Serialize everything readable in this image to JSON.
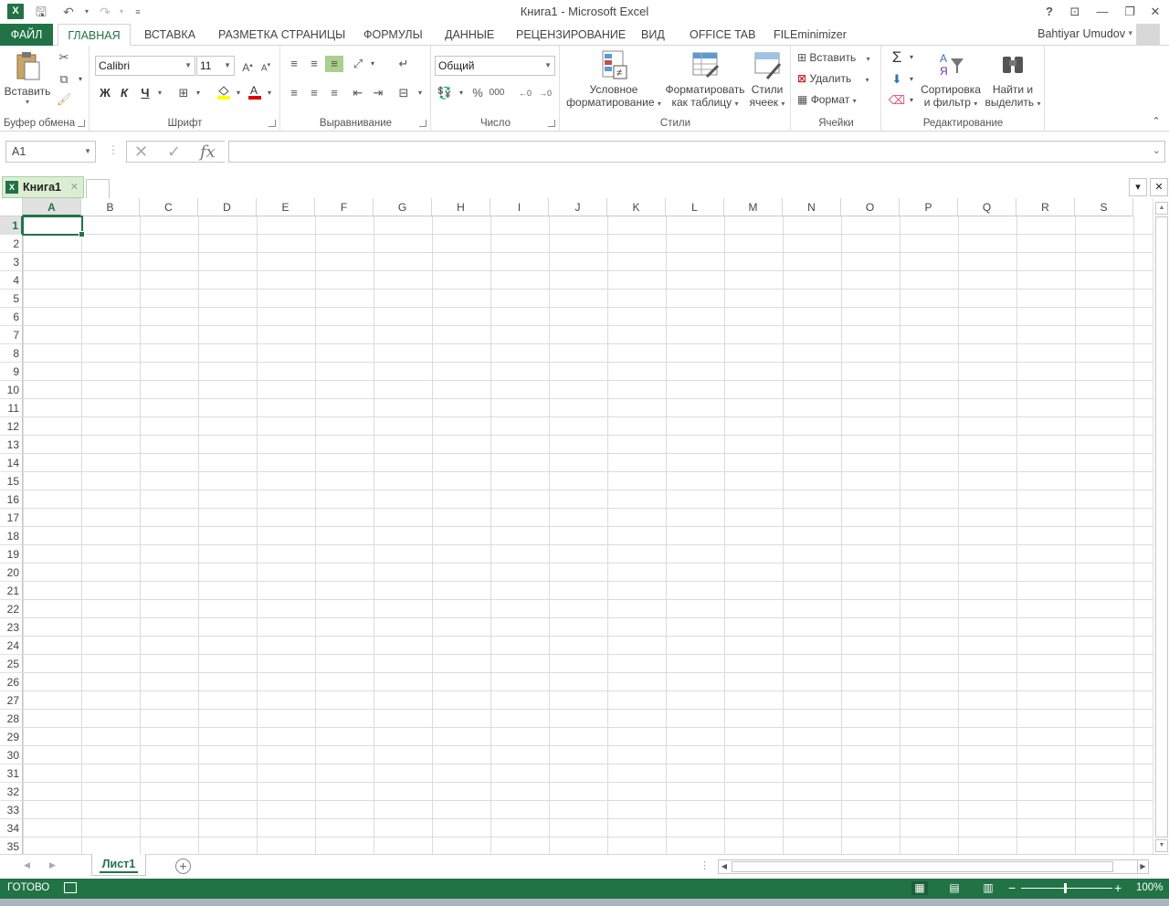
{
  "window": {
    "title": "Книга1 - Microsoft Excel",
    "help": "?",
    "minimize": "—",
    "restore": "❐",
    "close": "✕"
  },
  "tabs": [
    "ФАЙЛ",
    "ГЛАВНАЯ",
    "ВСТАВКА",
    "РАЗМЕТКА СТРАНИЦЫ",
    "ФОРМУЛЫ",
    "ДАННЫЕ",
    "РЕЦЕНЗИРОВАНИЕ",
    "ВИД",
    "OFFICE TAB",
    "FILEminimizer"
  ],
  "user": "Bahtiyar Umudov",
  "ribbon": {
    "clipboard": {
      "label": "Буфер обмена",
      "paste": "Вставить"
    },
    "font": {
      "label": "Шрифт",
      "font_name": "Calibri",
      "font_size": "11",
      "bold": "Ж",
      "italic": "К",
      "underline": "Ч"
    },
    "alignment": {
      "label": "Выравнивание"
    },
    "number": {
      "label": "Число",
      "format": "Общий",
      "percent": "%",
      "thousands": "000"
    },
    "styles": {
      "label": "Стили",
      "conditional_1": "Условное",
      "conditional_2": "форматирование",
      "format_table_1": "Форматировать",
      "format_table_2": "как таблицу",
      "cell_styles_1": "Стили",
      "cell_styles_2": "ячеек"
    },
    "cells": {
      "label": "Ячейки",
      "insert": "Вставить",
      "delete": "Удалить",
      "format": "Формат"
    },
    "editing": {
      "label": "Редактирование",
      "sort_1": "Сортировка",
      "sort_2": "и фильтр",
      "find_1": "Найти и",
      "find_2": "выделить"
    }
  },
  "formula_bar": {
    "name_box": "A1",
    "fx": "fx",
    "value": ""
  },
  "office_tab": {
    "doc_name": "Книга1"
  },
  "grid": {
    "columns": [
      "A",
      "B",
      "C",
      "D",
      "E",
      "F",
      "G",
      "H",
      "I",
      "J",
      "K",
      "L",
      "M",
      "N",
      "O",
      "P",
      "Q",
      "R",
      "S"
    ],
    "rows": [
      "1",
      "2",
      "3",
      "4",
      "5",
      "6",
      "7",
      "8",
      "9",
      "10",
      "11",
      "12",
      "13",
      "14",
      "15",
      "16",
      "17",
      "18",
      "19",
      "20",
      "21",
      "22",
      "23",
      "24",
      "25",
      "26",
      "27",
      "28",
      "29",
      "30",
      "31",
      "32",
      "33",
      "34",
      "35"
    ],
    "active_cell": "A1"
  },
  "sheets": [
    "Лист1"
  ],
  "status": {
    "ready": "ГОТОВО",
    "zoom": "100%"
  }
}
